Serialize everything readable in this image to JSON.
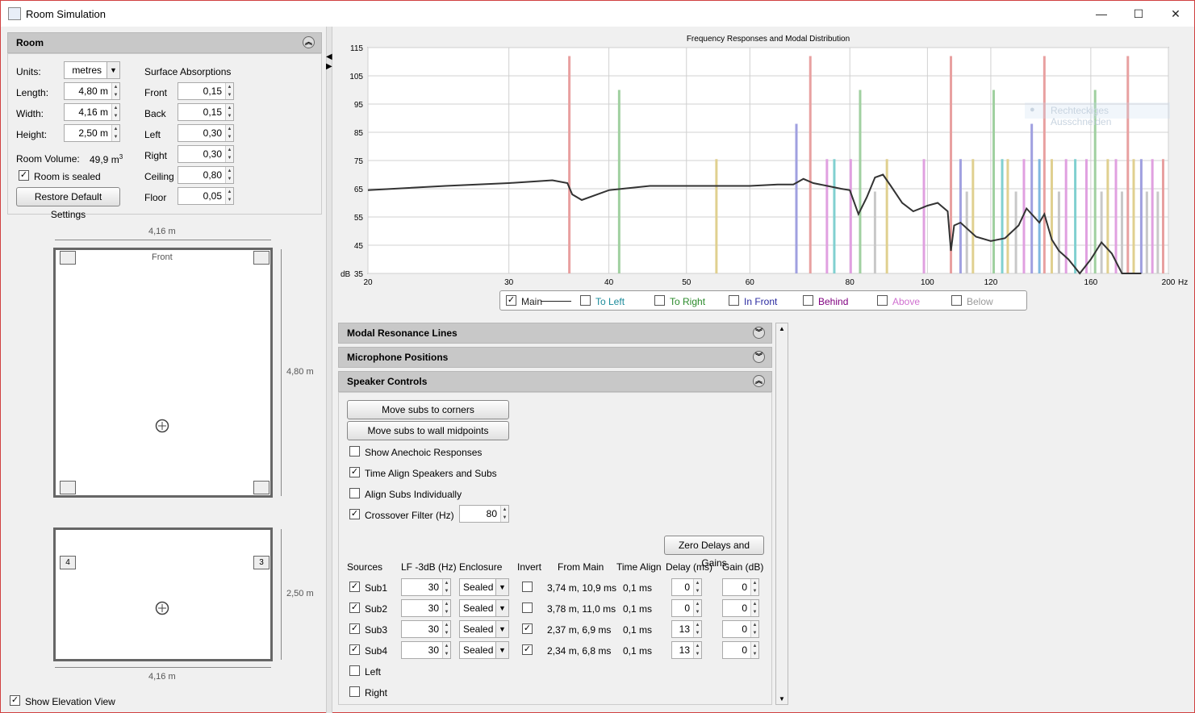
{
  "window": {
    "title": "Room Simulation",
    "minimize": "—",
    "maximize": "☐",
    "close": "✕"
  },
  "room": {
    "header": "Room",
    "units_label": "Units:",
    "units_value": "metres",
    "length_label": "Length:",
    "length_value": "4,80 m",
    "width_label": "Width:",
    "width_value": "4,16 m",
    "height_label": "Height:",
    "height_value": "2,50 m",
    "volume_label": "Room Volume:",
    "volume_value": "49,9 m",
    "volume_unit_sup": "3",
    "sealed_label": "Room is sealed",
    "sealed_checked": true,
    "restore_label": "Restore Default Settings",
    "surface_title": "Surface Absorptions",
    "surfaces": [
      {
        "label": "Front",
        "value": "0,15"
      },
      {
        "label": "Back",
        "value": "0,15"
      },
      {
        "label": "Left",
        "value": "0,30"
      },
      {
        "label": "Right",
        "value": "0,30"
      },
      {
        "label": "Ceiling",
        "value": "0,80"
      },
      {
        "label": "Floor",
        "value": "0,05"
      }
    ]
  },
  "plan": {
    "width_dim": "4,16 m",
    "length_dim": "4,80 m",
    "front_label": "Front",
    "elev_width_dim": "4,16 m",
    "height_dim": "2,50 m",
    "elev_spk_left": "4",
    "elev_spk_right": "3",
    "show_elevation_label": "Show Elevation View",
    "show_elevation_checked": true
  },
  "chart_data": {
    "type": "line",
    "title": "Frequency Responses and Modal Distribution",
    "ylabel": "dB",
    "xunit": "Hz",
    "xscale": "log",
    "xlim": [
      20,
      200
    ],
    "ylim": [
      35,
      115
    ],
    "xticks": [
      "20",
      "30",
      "40",
      "50",
      "60",
      "80",
      "100",
      "120",
      "160",
      "200"
    ],
    "xtick_values": [
      20,
      30,
      40,
      50,
      60,
      80,
      100,
      120,
      160,
      200
    ],
    "yticks": [
      35,
      45,
      55,
      65,
      75,
      85,
      95,
      105,
      115
    ],
    "grid": true,
    "series": [
      {
        "name": "Main",
        "color": "#333333",
        "x": [
          20,
          25,
          30,
          34,
          35.5,
          36,
          37,
          40,
          45,
          50,
          55,
          60,
          65,
          68,
          70,
          72,
          75,
          78,
          80,
          82,
          84,
          86,
          88,
          90,
          93,
          96,
          100,
          103,
          106,
          107,
          108,
          110,
          115,
          120,
          125,
          130,
          133,
          136,
          138,
          140,
          143,
          146,
          150,
          155,
          160,
          165,
          170,
          175,
          180,
          185
        ],
        "y": [
          64.5,
          66,
          67,
          68,
          67,
          63,
          61,
          64.5,
          66,
          66,
          66,
          66,
          66.5,
          66.5,
          68.5,
          67,
          66,
          65,
          64.5,
          56,
          62,
          69,
          70,
          66,
          60,
          57,
          59,
          60,
          57,
          43,
          52,
          53,
          48,
          46.5,
          47.5,
          52,
          58,
          55,
          53,
          56,
          47,
          43,
          40,
          30,
          40,
          46,
          42,
          35,
          32,
          30
        ]
      }
    ],
    "modal_lines": [
      {
        "freq": 35.7,
        "db": 112,
        "color": "#e8a0a0"
      },
      {
        "freq": 41.2,
        "db": 100,
        "color": "#a0d0a0"
      },
      {
        "freq": 54.5,
        "db": 75.5,
        "color": "#e0d090"
      },
      {
        "freq": 68.6,
        "db": 88,
        "color": "#a0a0e0"
      },
      {
        "freq": 71.4,
        "db": 112,
        "color": "#e8a0a0"
      },
      {
        "freq": 74.9,
        "db": 75.5,
        "color": "#e0a0e0"
      },
      {
        "freq": 76.5,
        "db": 75.5,
        "color": "#80d0d0"
      },
      {
        "freq": 80.2,
        "db": 75.5,
        "color": "#e0a0e0"
      },
      {
        "freq": 82.4,
        "db": 100,
        "color": "#a0d0a0"
      },
      {
        "freq": 86,
        "db": 64,
        "color": "#c8c8c8"
      },
      {
        "freq": 89,
        "db": 75.5,
        "color": "#e0d090"
      },
      {
        "freq": 99,
        "db": 75.5,
        "color": "#e0a0e0"
      },
      {
        "freq": 107,
        "db": 112,
        "color": "#e8a0a0"
      },
      {
        "freq": 110,
        "db": 75.5,
        "color": "#a0a0e0"
      },
      {
        "freq": 112,
        "db": 64,
        "color": "#c8c8c8"
      },
      {
        "freq": 114,
        "db": 75.5,
        "color": "#e0d090"
      },
      {
        "freq": 121,
        "db": 100,
        "color": "#a0d0a0"
      },
      {
        "freq": 124,
        "db": 75.5,
        "color": "#80d0d0"
      },
      {
        "freq": 126,
        "db": 75.5,
        "color": "#e0d090"
      },
      {
        "freq": 129,
        "db": 64,
        "color": "#c8c8c8"
      },
      {
        "freq": 132,
        "db": 75.5,
        "color": "#e0a0e0"
      },
      {
        "freq": 135,
        "db": 88,
        "color": "#a0a0e0"
      },
      {
        "freq": 138,
        "db": 75.5,
        "color": "#80b8e0"
      },
      {
        "freq": 140,
        "db": 112,
        "color": "#e8a0a0"
      },
      {
        "freq": 143,
        "db": 75.5,
        "color": "#e0d090"
      },
      {
        "freq": 146,
        "db": 64,
        "color": "#c8c8c8"
      },
      {
        "freq": 149,
        "db": 75.5,
        "color": "#e0a0e0"
      },
      {
        "freq": 153,
        "db": 75.5,
        "color": "#80d0d0"
      },
      {
        "freq": 158,
        "db": 75.5,
        "color": "#e0a0e0"
      },
      {
        "freq": 162,
        "db": 100,
        "color": "#a0d0a0"
      },
      {
        "freq": 165,
        "db": 64,
        "color": "#c8c8c8"
      },
      {
        "freq": 168,
        "db": 75.5,
        "color": "#e0d090"
      },
      {
        "freq": 172,
        "db": 75.5,
        "color": "#e0a0e0"
      },
      {
        "freq": 175,
        "db": 64,
        "color": "#c8c8c8"
      },
      {
        "freq": 178,
        "db": 112,
        "color": "#e8a0a0"
      },
      {
        "freq": 181,
        "db": 75.5,
        "color": "#e0d090"
      },
      {
        "freq": 185,
        "db": 75.5,
        "color": "#a0a0e0"
      },
      {
        "freq": 188,
        "db": 64,
        "color": "#c8c8c8"
      },
      {
        "freq": 191,
        "db": 75.5,
        "color": "#e0a0e0"
      },
      {
        "freq": 194,
        "db": 64,
        "color": "#c8c8c8"
      },
      {
        "freq": 197,
        "db": 75.5,
        "color": "#e8a0a0"
      }
    ],
    "legend": [
      {
        "label": "Main",
        "color": "#222222",
        "checked": true
      },
      {
        "label": "To Left",
        "color": "#1a8a9a",
        "checked": false
      },
      {
        "label": "To Right",
        "color": "#2a8a2a",
        "checked": false
      },
      {
        "label": "In Front",
        "color": "#2a2aa0",
        "checked": false
      },
      {
        "label": "Behind",
        "color": "#800080",
        "checked": false
      },
      {
        "label": "Above",
        "color": "#d070d0",
        "checked": false
      },
      {
        "label": "Below",
        "color": "#999999",
        "checked": false
      }
    ]
  },
  "overlay_text": "Rechteckiges Ausschneiden",
  "sections": {
    "modal": "Modal Resonance Lines",
    "mic": "Microphone Positions",
    "speaker": "Speaker Controls"
  },
  "speaker": {
    "move_corners": "Move subs to corners",
    "move_midpoints": "Move subs to wall midpoints",
    "anechoic_label": "Show Anechoic Responses",
    "anechoic_checked": false,
    "time_align_label": "Time Align Speakers and Subs",
    "time_align_checked": true,
    "align_subs_label": "Align Subs Individually",
    "align_subs_checked": false,
    "crossover_label": "Crossover Filter (Hz)",
    "crossover_checked": true,
    "crossover_value": "80",
    "zero_btn": "Zero Delays and Gains",
    "headers": [
      "Sources",
      "LF -3dB (Hz)",
      "Enclosure",
      "Invert",
      "From Main",
      "Time Align",
      "Delay (ms)",
      "Gain (dB)"
    ],
    "rows": [
      {
        "name": "Sub1",
        "checked": true,
        "lf": "30",
        "enclosure": "Sealed",
        "invert": false,
        "from_main": "3,74 m, 10,9 ms",
        "time_align": "0,1 ms",
        "delay": "0",
        "gain": "0"
      },
      {
        "name": "Sub2",
        "checked": true,
        "lf": "30",
        "enclosure": "Sealed",
        "invert": false,
        "from_main": "3,78 m, 11,0 ms",
        "time_align": "0,1 ms",
        "delay": "0",
        "gain": "0"
      },
      {
        "name": "Sub3",
        "checked": true,
        "lf": "30",
        "enclosure": "Sealed",
        "invert": true,
        "from_main": "2,37 m, 6,9 ms",
        "time_align": "0,1 ms",
        "delay": "13",
        "gain": "0"
      },
      {
        "name": "Sub4",
        "checked": true,
        "lf": "30",
        "enclosure": "Sealed",
        "invert": true,
        "from_main": "2,34 m, 6,8 ms",
        "time_align": "0,1 ms",
        "delay": "13",
        "gain": "0"
      }
    ],
    "extra_sources": [
      {
        "name": "Left",
        "checked": false
      },
      {
        "name": "Right",
        "checked": false
      }
    ]
  }
}
